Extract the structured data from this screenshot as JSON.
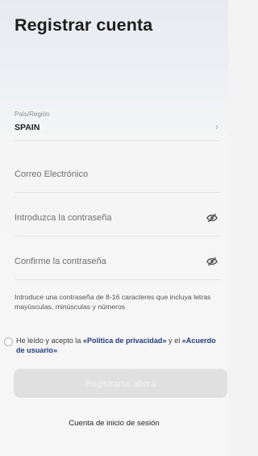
{
  "header": {
    "title": "Registrar cuenta"
  },
  "country": {
    "label": "País/Región",
    "value": "SPAIN",
    "chevron_icon": "chevron-right-icon"
  },
  "form": {
    "email_placeholder": "Correo Electrónico",
    "password_placeholder": "Introduzca la contraseña",
    "confirm_placeholder": "Confirme la contraseña",
    "visibility_icon": "eye-off-icon",
    "password_hint": "Introduce una contraseña de 8-16 caracteres que incluya letras mayúsculas, minúsculas y números"
  },
  "agreement": {
    "prefix": "He leído y acepto la ",
    "privacy_link": "«Política de privacidad»",
    "middle": " y el ",
    "user_link": "«Acuerdo de usuario»"
  },
  "actions": {
    "register_label": "Registrarse ahora",
    "login_link": "Cuenta de inicio de sesión"
  },
  "colors": {
    "link": "#233d84",
    "button_disabled_bg": "#e0e0e0",
    "button_disabled_text": "#f3f3f3"
  }
}
